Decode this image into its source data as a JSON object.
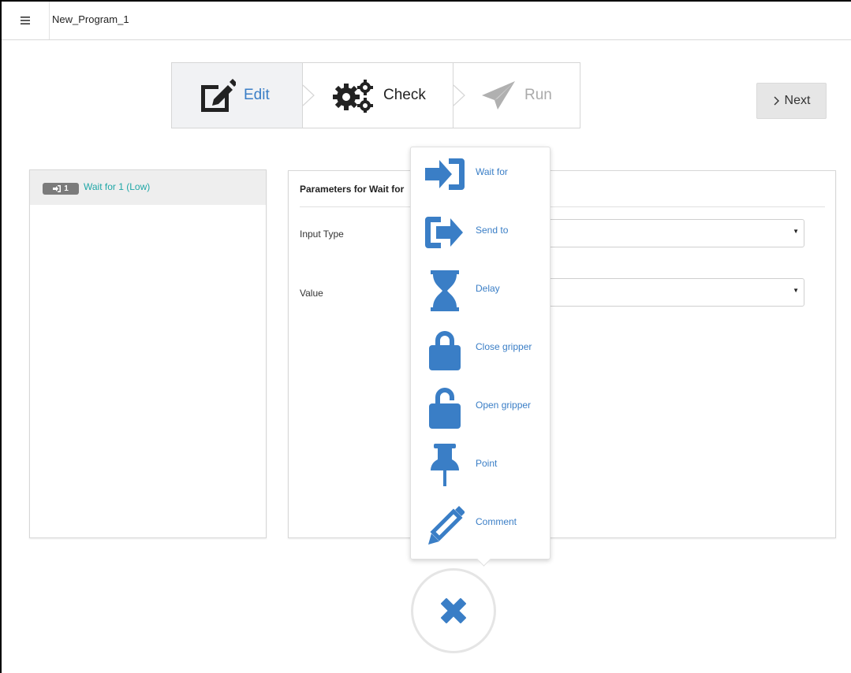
{
  "topbar": {
    "menu_icon": "hamburger-menu-icon",
    "program_name": "New_Program_1"
  },
  "wizard": {
    "steps": [
      {
        "label": "Edit",
        "icon": "edit-icon",
        "state": "active"
      },
      {
        "label": "Check",
        "icon": "gears-icon",
        "state": "normal"
      },
      {
        "label": "Run",
        "icon": "paper-plane-icon",
        "state": "disabled"
      }
    ],
    "next_label": "Next",
    "next_icon": "chevron-right-icon"
  },
  "program_list": {
    "items": [
      {
        "badge_number": "1",
        "badge_icon": "sign-in-icon",
        "label": "Wait for 1 (Low)"
      }
    ]
  },
  "parameters": {
    "title": "Parameters for  Wait for",
    "fields": [
      {
        "label": "Input Type",
        "value": ""
      },
      {
        "label": "Value",
        "value": ""
      }
    ]
  },
  "popup_menu": {
    "items": [
      {
        "label": "Wait for",
        "icon": "sign-in-icon"
      },
      {
        "label": "Send to",
        "icon": "sign-out-icon"
      },
      {
        "label": "Delay",
        "icon": "hourglass-icon"
      },
      {
        "label": "Close gripper",
        "icon": "lock-icon"
      },
      {
        "label": "Open gripper",
        "icon": "unlock-icon"
      },
      {
        "label": "Point",
        "icon": "thumbtack-icon"
      },
      {
        "label": "Comment",
        "icon": "pencil-icon"
      }
    ]
  },
  "close_button": {
    "icon": "close-icon"
  },
  "colors": {
    "accent": "#3a7ec6",
    "teal": "#1fa7a7",
    "inactive": "#aaaaaa",
    "badge": "#7b7b7b"
  }
}
